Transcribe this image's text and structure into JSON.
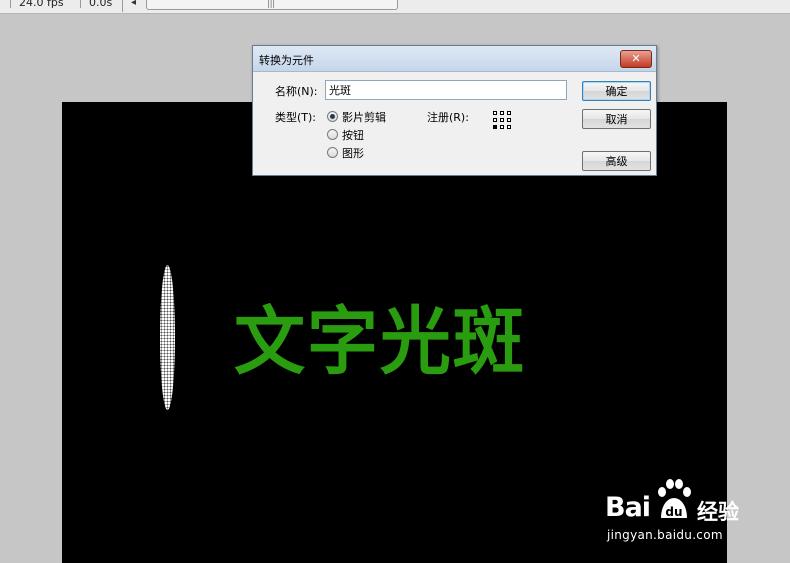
{
  "timeline": {
    "fps": "24.0 fps",
    "time": "0.0s",
    "scroll_arrow": "◂",
    "scroll_grip": "|||"
  },
  "stage": {
    "background": "#000000",
    "text": "文字光斑",
    "text_color": "#2a9c10"
  },
  "dialog": {
    "title": "转换为元件",
    "close_label": "✕",
    "name_label": "名称(N):",
    "name_value": "光斑",
    "type_label": "类型(T):",
    "type_options": [
      "影片剪辑",
      "按钮",
      "图形"
    ],
    "selected_type": "影片剪辑",
    "registration_label": "注册(R):",
    "buttons": {
      "ok": "确定",
      "cancel": "取消",
      "advanced": "高级"
    }
  },
  "watermark": {
    "brand": "Bai",
    "brand_paw": "du",
    "jingyan": "经验",
    "url": "jingyan.baidu.com"
  }
}
